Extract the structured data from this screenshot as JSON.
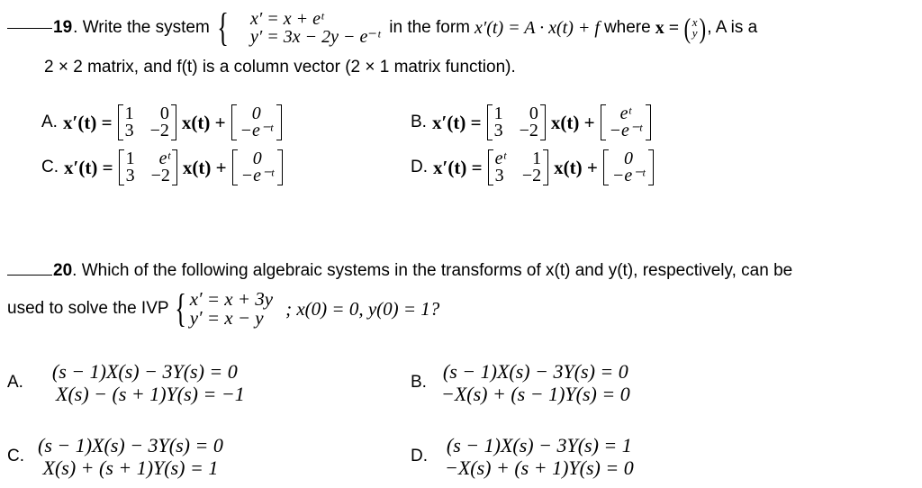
{
  "q19": {
    "number": "19",
    "intro": ". Write the system",
    "system": [
      "x′ = x + eᵗ",
      "y′ = 3x − 2y − e⁻ᵗ"
    ],
    "text_mid": "in the form",
    "form": "x′(t) = A · x(t) + f",
    "where": "where",
    "x_def": "x =",
    "x_vec": [
      "x",
      "y"
    ],
    "tail": ", A is a",
    "line2": "2 × 2 matrix, and f(t) is a column vector (2 × 1 matrix function).",
    "options": [
      {
        "label": "A.",
        "lhs": "x′(t) =",
        "matrix": [
          [
            "1",
            "0"
          ],
          [
            "3",
            "−2"
          ]
        ],
        "mid": "x(t) +",
        "vector": [
          "0",
          "−e⁻ᵗ"
        ]
      },
      {
        "label": "B.",
        "lhs": "x′(t) =",
        "matrix": [
          [
            "1",
            "0"
          ],
          [
            "3",
            "−2"
          ]
        ],
        "mid": "x(t) +",
        "vector": [
          "eᵗ",
          "−e⁻ᵗ"
        ]
      },
      {
        "label": "C.",
        "lhs": "x′(t) =",
        "matrix": [
          [
            "1",
            "eᵗ"
          ],
          [
            "3",
            "−2"
          ]
        ],
        "mid": "x(t) +",
        "vector": [
          "0",
          "−e⁻ᵗ"
        ]
      },
      {
        "label": "D.",
        "lhs": "x′(t) =",
        "matrix": [
          [
            "eᵗ",
            "1"
          ],
          [
            "3",
            "−2"
          ]
        ],
        "mid": "x(t) +",
        "vector": [
          "0",
          "−e⁻ᵗ"
        ]
      }
    ]
  },
  "q20": {
    "number": "20",
    "line1": ".  Which of the following algebraic systems in the transforms of x(t) and y(t), respectively, can be",
    "line2_prefix": "used to solve the  IVP",
    "system": [
      "x′ = x + 3y",
      "y′ = x − y"
    ],
    "conditions": "; x(0) = 0, y(0) = 1?",
    "options": [
      {
        "label": "A.",
        "eqs": [
          "(s − 1)X(s) − 3Y(s) = 0",
          "X(s) − (s + 1)Y(s) = −1"
        ]
      },
      {
        "label": "B.",
        "eqs": [
          "(s − 1)X(s) − 3Y(s) = 0",
          "−X(s) + (s − 1)Y(s) = 0"
        ]
      },
      {
        "label": "C.",
        "eqs": [
          "(s − 1)X(s) − 3Y(s) = 0",
          "X(s) + (s + 1)Y(s) = 1"
        ]
      },
      {
        "label": "D.",
        "eqs": [
          "(s − 1)X(s) − 3Y(s) = 1",
          "−X(s) + (s + 1)Y(s) = 0"
        ]
      }
    ]
  }
}
